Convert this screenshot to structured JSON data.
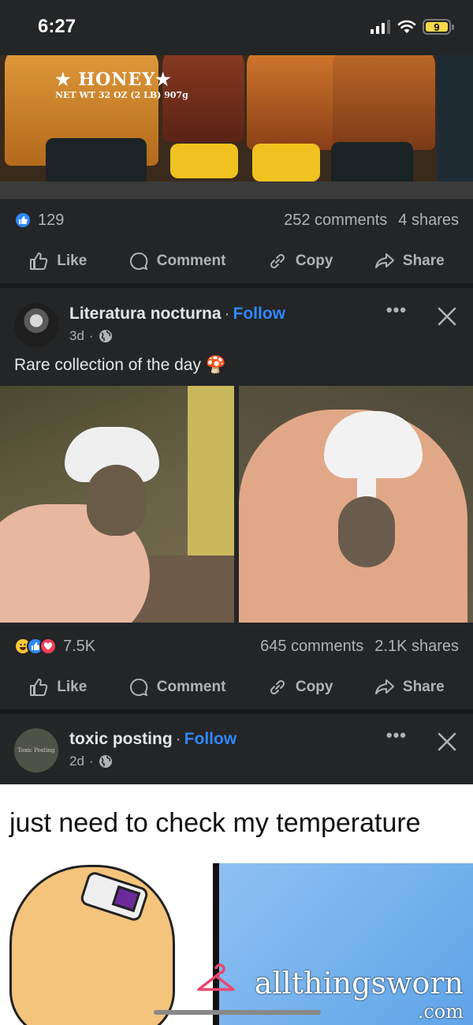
{
  "status": {
    "time": "6:27",
    "battery": "9"
  },
  "post1": {
    "photo_text": {
      "brand": "★ HONEY★",
      "netwt": "NET WT 32 OZ (2 LB) 907g"
    },
    "reactions": "129",
    "comments": "252 comments",
    "shares": "4 shares",
    "actions": {
      "like": "Like",
      "comment": "Comment",
      "copy": "Copy",
      "share": "Share"
    }
  },
  "post2": {
    "author": "Literatura nocturna",
    "follow": "Follow",
    "time": "3d",
    "caption": "Rare collection of the day 🍄",
    "reactions": "7.5K",
    "comments": "645 comments",
    "shares": "2.1K shares",
    "actions": {
      "like": "Like",
      "comment": "Comment",
      "copy": "Copy",
      "share": "Share"
    }
  },
  "post3": {
    "author": "toxic posting",
    "follow": "Follow",
    "time": "2d",
    "avatar_text": "Toxic Posting",
    "meme_text": "just need to check my temperature",
    "watermark": "allthingsworn",
    "watermark_sub": ".com"
  },
  "colors": {
    "background": "#242526",
    "separator": "#18191a",
    "link": "#2d88ff",
    "muted": "#b0b3b8"
  }
}
